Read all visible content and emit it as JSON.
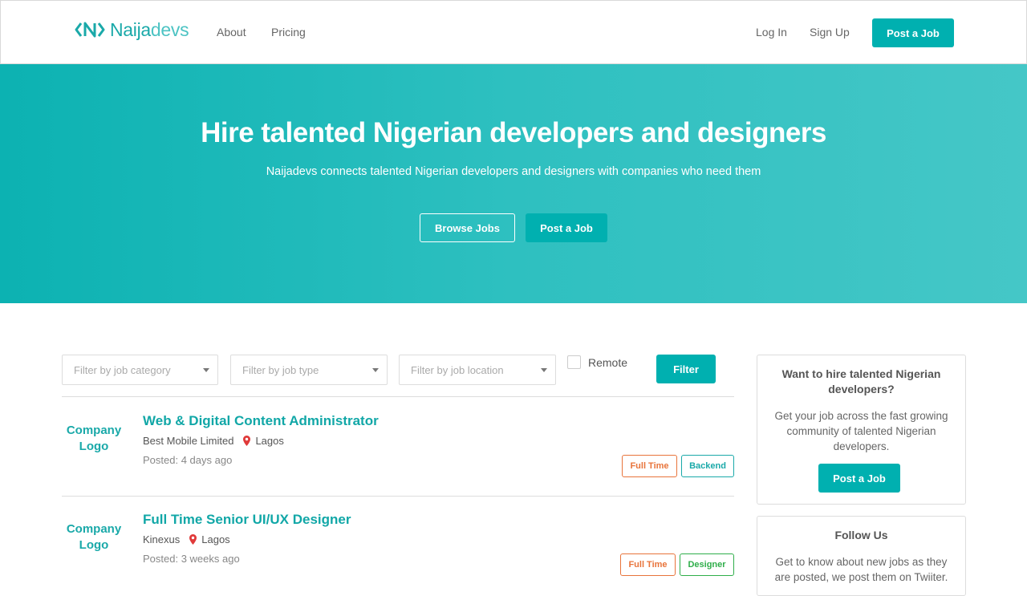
{
  "brand": {
    "name_part1": "Naija",
    "name_part2": "devs"
  },
  "nav": {
    "about": "About",
    "pricing": "Pricing",
    "login": "Log In",
    "signup": "Sign Up",
    "post_job": "Post a Job"
  },
  "hero": {
    "title": "Hire talented Nigerian developers and designers",
    "subtitle": "Naijadevs connects talented Nigerian developers and designers with companies who need them",
    "browse_label": "Browse Jobs",
    "post_label": "Post a Job"
  },
  "filters": {
    "category_placeholder": "Filter by job category",
    "type_placeholder": "Filter by job type",
    "location_placeholder": "Filter by job location",
    "remote_label": "Remote",
    "filter_button": "Filter"
  },
  "jobs": [
    {
      "logo_line1": "Company",
      "logo_line2": "Logo",
      "title": "Web & Digital Content Administrator",
      "company": "Best Mobile Limited",
      "location": "Lagos",
      "posted": "Posted: 4 days ago",
      "tags": [
        "Full Time",
        "Backend"
      ]
    },
    {
      "logo_line1": "Company",
      "logo_line2": "Logo",
      "title": "Full Time Senior UI/UX Designer",
      "company": "Kinexus",
      "location": "Lagos",
      "posted": "Posted: 3 weeks ago",
      "tags": [
        "Full Time",
        "Designer"
      ]
    }
  ],
  "sidebar": {
    "hire_title": "Want to hire talented Nigerian developers?",
    "hire_text": "Get your job across the fast growing community of talented Nigerian developers.",
    "hire_button": "Post a Job",
    "follow_title": "Follow Us",
    "follow_text": "Get to know about new jobs as they are posted, we post them on Twiiter."
  },
  "colors": {
    "accent": "#00b0b0",
    "full_time": "#e8743b",
    "backend": "#1aa9a9",
    "designer": "#2fae4a",
    "pin": "#e03a3a"
  }
}
